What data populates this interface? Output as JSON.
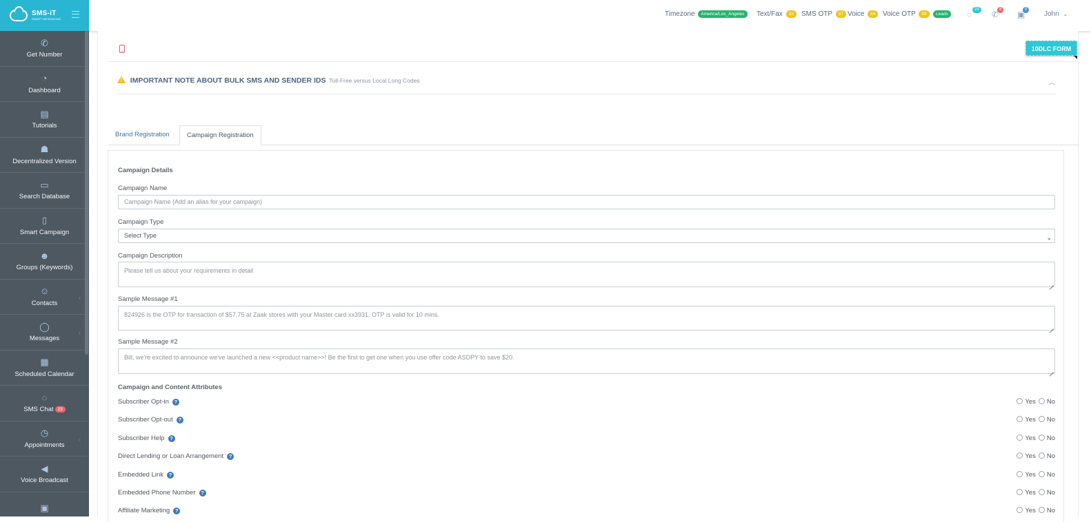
{
  "brand": {
    "name": "SMS-iT",
    "tagline": "SMART MESSAGING"
  },
  "sidebar": {
    "items": [
      {
        "label": "Get Number",
        "icon": "phone-icon",
        "glyph": "✆"
      },
      {
        "label": "Dashboard",
        "icon": "dashboard-gauge-icon",
        "glyph": "◔"
      },
      {
        "label": "Tutorials",
        "icon": "book-icon",
        "glyph": "▤"
      },
      {
        "label": "Decentralized Version",
        "icon": "android-icon",
        "glyph": "☗"
      },
      {
        "label": "Search Database",
        "icon": "laptop-icon",
        "glyph": "▭"
      },
      {
        "label": "Smart Campaign",
        "icon": "mobile-icon",
        "glyph": "▯"
      },
      {
        "label": "Groups (Keywords)",
        "icon": "users-icon",
        "glyph": "☻"
      },
      {
        "label": "Contacts",
        "icon": "user-icon",
        "glyph": "☺"
      },
      {
        "label": "Messages",
        "icon": "chat-bubble-icon",
        "glyph": "◯"
      },
      {
        "label": "Scheduled Calendar",
        "icon": "calendar-icon",
        "glyph": "▦"
      },
      {
        "label": "SMS Chat",
        "icon": "chat-dots-icon",
        "glyph": "◌",
        "badge": "23"
      },
      {
        "label": "Appointments",
        "icon": "clock-icon",
        "glyph": "◷"
      },
      {
        "label": "Voice Broadcast",
        "icon": "megaphone-icon",
        "glyph": "◀"
      },
      {
        "label": "",
        "icon": "fax-icon",
        "glyph": "▣"
      }
    ]
  },
  "topbar": {
    "timezone_label": "Timezone",
    "timezone_value": "America/Los_Angeles",
    "textfax_label": "Text/Fax",
    "textfax_count": "32",
    "smsotp_label": "SMS OTP",
    "smsotp_count": "97",
    "voice_label": "Voice",
    "voice_count": "84",
    "voiceotp_label": "Voice OTP",
    "voiceotp_count": "99",
    "leads_label": "Leads",
    "chat_badge": "23",
    "calls_badge": "8",
    "cart_badge": "0",
    "user_name": "John"
  },
  "main": {
    "dlc_button": "10DLC FORM",
    "note_title": "IMPORTANT NOTE ABOUT BULK SMS AND SENDER IDS",
    "note_subtitle": "Toll-Free versus Local Long Codes",
    "tabs": [
      {
        "label": "Brand Registration",
        "active": false
      },
      {
        "label": "Campaign Registration",
        "active": true
      }
    ]
  },
  "form": {
    "section_details": "Campaign Details",
    "campaign_name_label": "Campaign Name",
    "campaign_name_placeholder": "Campaign Name (Add an alias for your campaign)",
    "campaign_type_label": "Campaign Type",
    "campaign_type_value": "Select Type",
    "campaign_description_label": "Campaign Description",
    "campaign_description_placeholder": "Please tell us about your requirements in detail",
    "sample1_label": "Sample Message #1",
    "sample1_placeholder": "824926 is the OTP for transaction of  $57.75 at Zaak stores with your Master card xx3931. OTP is valid for 10 mins.",
    "sample2_label": "Sample Message #2",
    "sample2_placeholder": "Bill, we're excited to announce we've launched a new <<product name>>! Be the first to get one when you use offer code ASDPY to save $20.",
    "section_attributes": "Campaign and Content Attributes",
    "yes_label": "Yes",
    "no_label": "No",
    "attributes": [
      "Subscriber Opt-in",
      "Subscriber Opt-out",
      "Subscriber Help",
      "Direct Lending or Loan Arrangement",
      "Embedded Link",
      "Embedded Phone Number",
      "Affiliate Marketing"
    ]
  },
  "colors": {
    "sidebar": "#4e5861",
    "brand": "#29b6d3",
    "accent": "#2ec7d6",
    "green_pill": "#27b36b",
    "yellow_pill": "#f0c419",
    "warning": "#f3be1f",
    "link": "#3d6ea3"
  }
}
